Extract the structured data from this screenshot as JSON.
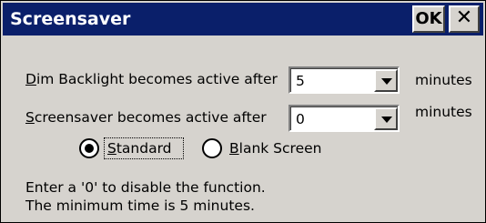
{
  "window": {
    "title": "Screensaver",
    "ok_label": "OK",
    "close_label": "✕"
  },
  "dim_backlight": {
    "label_mnemonic": "D",
    "label_rest": "im Backlight becomes active after",
    "value": "5",
    "unit": "minutes"
  },
  "screensaver": {
    "label_mnemonic": "S",
    "label_rest": "creensaver becomes active after",
    "value": "0",
    "unit": "minutes"
  },
  "mode": {
    "standard_mnemonic": "S",
    "standard_rest": "tandard",
    "standard_selected": true,
    "blank_mnemonic": "B",
    "blank_rest": "lank Screen",
    "blank_selected": false
  },
  "help": {
    "line1": "Enter a '0' to disable the function.",
    "line2": "The minimum time is 5 minutes."
  },
  "colors": {
    "title_bar": "#0a1f6a",
    "window_bg": "#d6d3ce"
  }
}
